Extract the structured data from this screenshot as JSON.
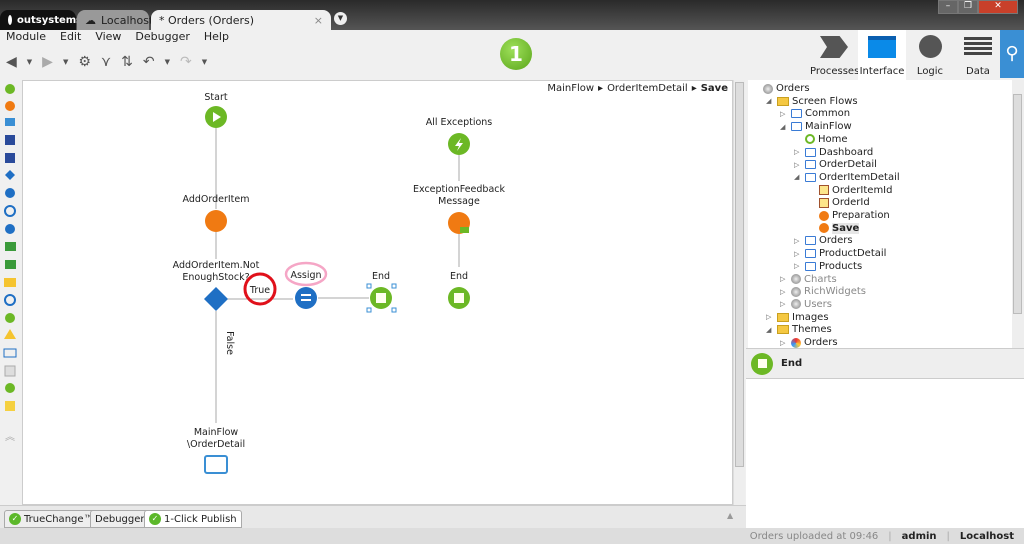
{
  "window": {
    "tabs": [
      {
        "label": "outsystems"
      },
      {
        "label": "Localhost"
      },
      {
        "label": "* Orders (Orders)"
      }
    ],
    "close": "×",
    "minimize": "–",
    "restore": "❐",
    "close_window": "✕"
  },
  "menu": [
    "Module",
    "Edit",
    "View",
    "Debugger",
    "Help"
  ],
  "toolbar": {
    "step_number": "1"
  },
  "nav_tabs": [
    {
      "label": "Processes"
    },
    {
      "label": "Interface",
      "active": true
    },
    {
      "label": "Logic"
    },
    {
      "label": "Data"
    }
  ],
  "breadcrumb": [
    "MainFlow",
    "OrderItemDetail",
    "Save"
  ],
  "flow": {
    "start": "Start",
    "add_order_item": "AddOrderItem",
    "condition_1": "AddOrderItem.Not",
    "condition_2": "EnoughStock?",
    "true_label": "True",
    "false_label": "False",
    "assign": "Assign",
    "end": "End",
    "destination_1": "MainFlow",
    "destination_2": "\\OrderDetail",
    "all_exceptions": "All Exceptions",
    "exception_1": "ExceptionFeedback",
    "exception_2": "Message",
    "exception_end": "End"
  },
  "tree": [
    {
      "label": "Orders",
      "level": 0
    },
    {
      "label": "Screen Flows",
      "level": 1
    },
    {
      "label": "Common",
      "level": 2
    },
    {
      "label": "MainFlow",
      "level": 2
    },
    {
      "label": "Home",
      "level": 3
    },
    {
      "label": "Dashboard",
      "level": 3
    },
    {
      "label": "OrderDetail",
      "level": 3
    },
    {
      "label": "OrderItemDetail",
      "level": 3
    },
    {
      "label": "OrderItemId",
      "level": 4
    },
    {
      "label": "OrderId",
      "level": 4
    },
    {
      "label": "Preparation",
      "level": 4
    },
    {
      "label": "Save",
      "level": 4,
      "selected": true
    },
    {
      "label": "Orders",
      "level": 3
    },
    {
      "label": "ProductDetail",
      "level": 3
    },
    {
      "label": "Products",
      "level": 3
    },
    {
      "label": "Charts",
      "level": 2
    },
    {
      "label": "RichWidgets",
      "level": 2
    },
    {
      "label": "Users",
      "level": 2
    },
    {
      "label": "Images",
      "level": 1
    },
    {
      "label": "Themes",
      "level": 1
    },
    {
      "label": "Orders",
      "level": 2
    }
  ],
  "properties": {
    "title": "End"
  },
  "bottom_tabs": [
    {
      "label": "TrueChange™"
    },
    {
      "label": "Debugger"
    },
    {
      "label": "1-Click Publish"
    }
  ],
  "status": {
    "message": "Orders uploaded at 09:46",
    "user": "admin",
    "server": "Localhost"
  },
  "colors": {
    "accent": "#3a8fd4",
    "green": "#6cb825",
    "orange": "#f07a12",
    "blue_node": "#1f6fc4",
    "annotation_red": "#e0101a",
    "annotation_pink": "#f5a6c6"
  }
}
